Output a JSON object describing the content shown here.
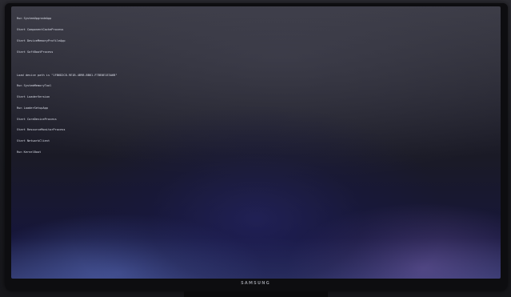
{
  "monitor": {
    "brand": "SAMSUNG"
  },
  "console": {
    "block1": [
      "Run SystemUpgradeApp",
      "Start ComponentCacheProcess",
      "Start DeviceMemoryProfileApp",
      "Start SoftBootProcess"
    ],
    "block2": [
      "Load device path is \"1FB6D2C8-9E1B-4B9B-BB61-F7BE0E1E3A6B\"",
      "Run SystemMemoryTool",
      "Start LoaderVersion",
      "Run LoaderSetupApp",
      "Start CoreDeviceProcess",
      "Start ResourceMonitorProcess",
      "Start NetworkClient",
      "Run KernelBoot"
    ]
  },
  "colors": {
    "console_text": "#dcdfea",
    "screen_top": "#3b3b45",
    "screen_bottom": "#2e3568",
    "bezel": "#0d0d10"
  }
}
